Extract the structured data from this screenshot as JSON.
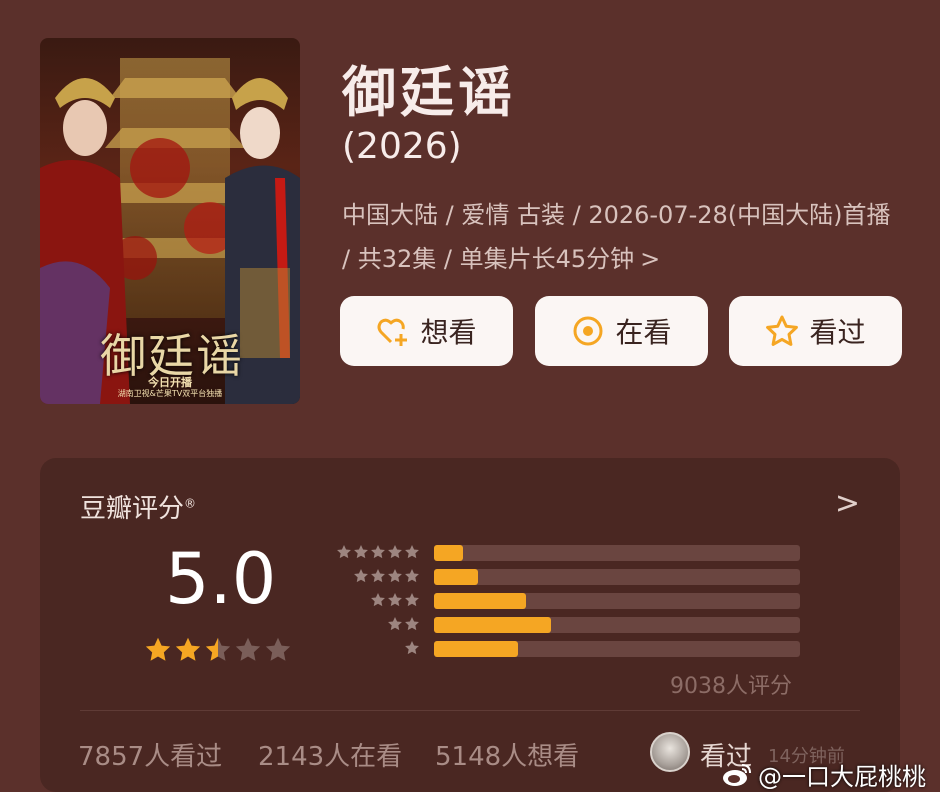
{
  "poster": {
    "title_art": "御廷谣",
    "line1": "今日开播",
    "line2": "湖南卫视&芒果TV双平台独播"
  },
  "header": {
    "title": "御廷谣",
    "year": "(2026)",
    "meta": "中国大陆 / 爱情 古装 / 2026-07-28(中国大陆)首播 / 共32集 / 单集片长45分钟",
    "meta_chevron": ">"
  },
  "actions": {
    "want_label": "想看",
    "watching_label": "在看",
    "watched_label": "看过"
  },
  "rating_card": {
    "title": "豆瓣评分",
    "registered_mark": "®",
    "chevron": ">",
    "score": "5.0",
    "score_stars": 2.5,
    "distribution": [
      {
        "stars": 5,
        "fraction": 0.08
      },
      {
        "stars": 4,
        "fraction": 0.12
      },
      {
        "stars": 3,
        "fraction": 0.25
      },
      {
        "stars": 2,
        "fraction": 0.32
      },
      {
        "stars": 1,
        "fraction": 0.23
      }
    ],
    "ratings_count": "9038人评分",
    "stats": {
      "watched": "7857人看过",
      "watching": "2143人在看",
      "want": "5148人想看"
    },
    "activity_label": "看过",
    "activity_time": "14分钟前"
  },
  "watermark": {
    "text": "@一口大屁桃桃"
  },
  "colors": {
    "background": "#5b302b",
    "card": "#4a2722",
    "accent": "#f5a623",
    "button_bg": "#fbf6f4"
  }
}
